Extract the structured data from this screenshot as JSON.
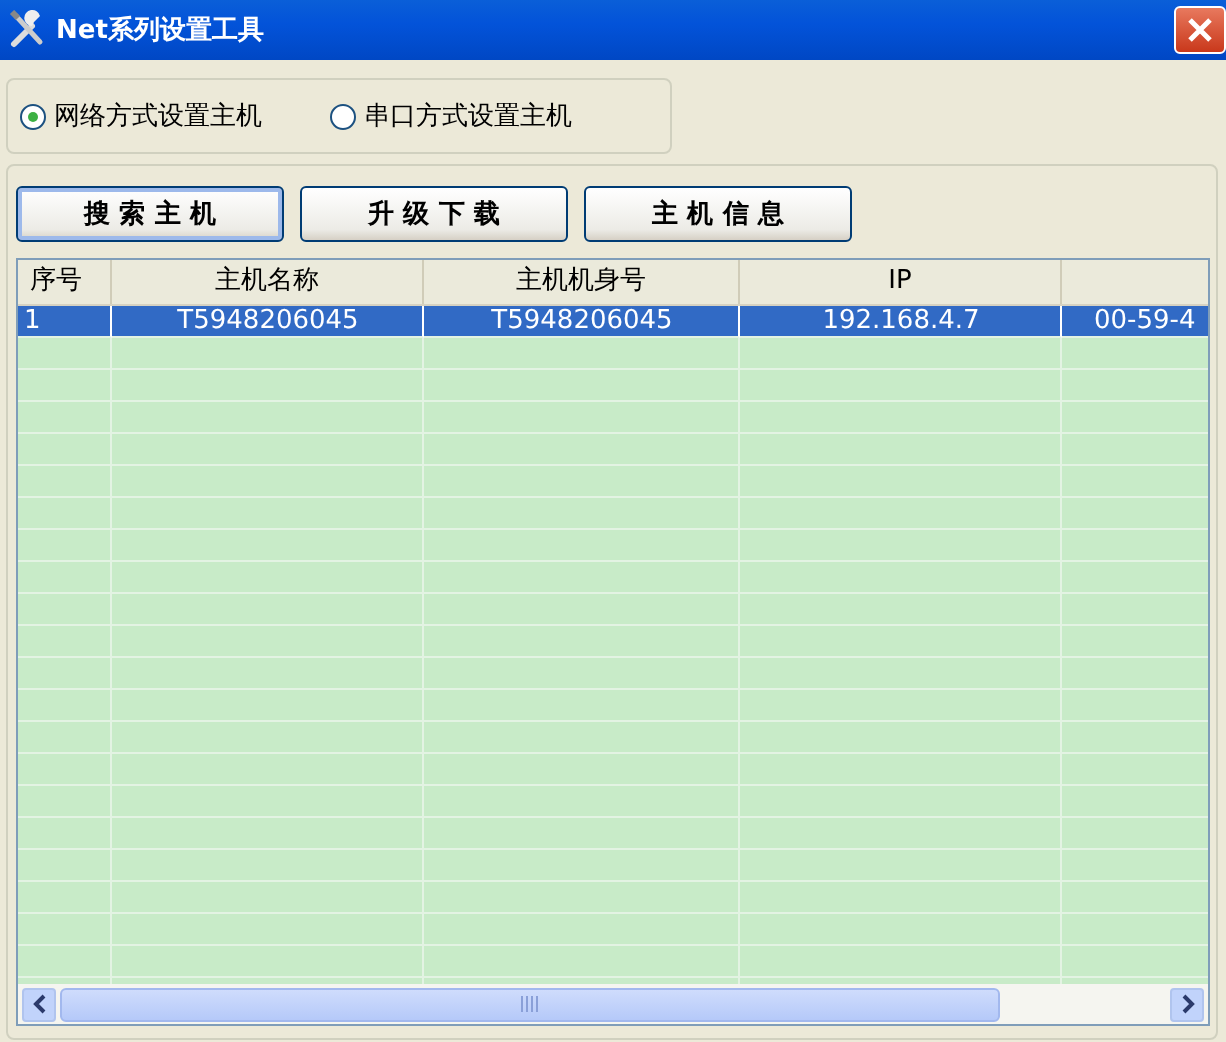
{
  "window": {
    "title": "Net系列设置工具"
  },
  "mode_options": [
    {
      "label": "网络方式设置主机",
      "selected": true
    },
    {
      "label": "串口方式设置主机",
      "selected": false
    }
  ],
  "buttons": [
    "搜 索 主 机",
    "升 级 下 载",
    "主 机 信 息"
  ],
  "table": {
    "columns": [
      "序号",
      "主机名称",
      "主机机身号",
      "IP"
    ],
    "rows": [
      {
        "selected": true,
        "cells": [
          "1",
          "T5948206045",
          "T5948206045",
          "192.168.4.7",
          "00-59-4"
        ]
      }
    ]
  }
}
